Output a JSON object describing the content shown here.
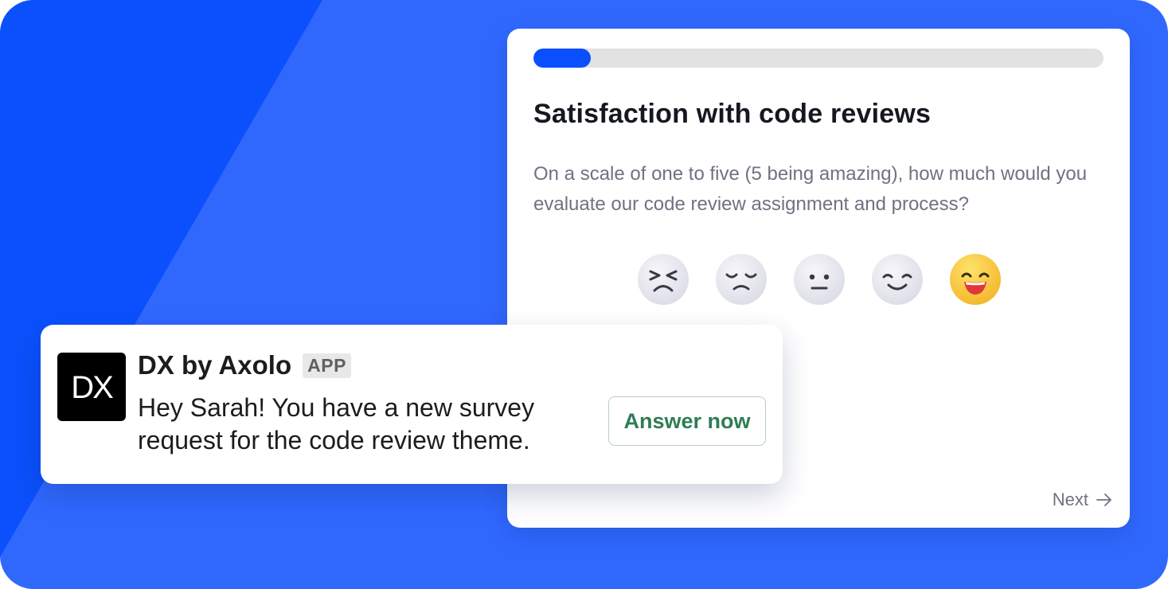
{
  "survey": {
    "progress_fraction": 0.1,
    "title": "Satisfaction with code reviews",
    "question": "On a scale of one to five (5 being amazing), how much would you evaluate our code review assignment and process?",
    "ratings": [
      {
        "value": 1,
        "icon": "angry-face-icon",
        "selected": false
      },
      {
        "value": 2,
        "icon": "sad-face-icon",
        "selected": false
      },
      {
        "value": 3,
        "icon": "neutral-face-icon",
        "selected": false
      },
      {
        "value": 4,
        "icon": "smiling-face-icon",
        "selected": false
      },
      {
        "value": 5,
        "icon": "grinning-face-icon",
        "selected": true
      }
    ],
    "next_label": "Next",
    "next_icon": "arrow-right-icon"
  },
  "notification": {
    "logo_text": "DX",
    "app_name": "DX by Axolo",
    "badge": "APP",
    "message": "Hey Sarah! You have a new survey request for the code review theme.",
    "action_label": "Answer now"
  },
  "colors": {
    "background": "#3068fe",
    "background_shard": "#0b50fc",
    "progress_fill": "#0a4ffd",
    "progress_track": "#e2e2e2",
    "selected_face": "#f9c740",
    "unselected_face": "#e6e6ee",
    "action_text": "#2e7d55"
  }
}
